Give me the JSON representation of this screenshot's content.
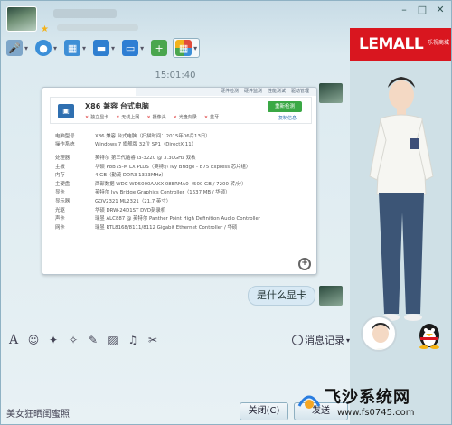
{
  "header": {
    "window_controls": [
      "–",
      "□",
      "✕"
    ]
  },
  "toolbar": {
    "items": [
      {
        "icon": "microphone-icon",
        "color": "#7ea6c9"
      },
      {
        "icon": "video-camera-icon",
        "color": "#3b8fd8"
      },
      {
        "icon": "screen-share-icon",
        "color": "#3f8fd6"
      },
      {
        "icon": "folder-icon",
        "color": "#2f7fd0"
      },
      {
        "icon": "remote-desktop-icon",
        "color": "#2e7ed3"
      },
      {
        "icon": "new-discussion-icon",
        "color": "#4aa64e"
      },
      {
        "icon": "app-grid-icon",
        "color": "#e14b3b"
      }
    ]
  },
  "chat": {
    "time": "15:01:40",
    "screenshot": {
      "tabs": [
        "硬件检测",
        "硬件监测",
        "性能测试",
        "驱动管理"
      ],
      "title": "X86 兼容 台式电脑",
      "checks": [
        "独立显卡",
        "无线上网",
        "摄像头",
        "光盘刻录",
        "蓝牙"
      ],
      "button": "重新检测",
      "link": "复制信息",
      "specs": [
        {
          "k": "电脑型号",
          "v": "X86 兼容 台式电脑（扫描时间：2015年06月13日）",
          "gap": false
        },
        {
          "k": "操作系统",
          "v": "Windows 7 旗舰版 32位 SP1（DirectX 11）",
          "gap": false
        },
        {
          "k": "处理器",
          "v": "英特尔 第三代酷睿 i3-3220 @ 3.30GHz 双核",
          "gap": true
        },
        {
          "k": "主板",
          "v": "华硕 P8B75-M LX PLUS（英特尔 Ivy Bridge - B75 Express 芯片组）",
          "gap": false
        },
        {
          "k": "内存",
          "v": "4 GB（勤茂 DDR3 1333MHz）",
          "gap": false
        },
        {
          "k": "主硬盘",
          "v": "西部数据 WDC WD5000AAKX-08ERMA0（500 GB / 7200 转/分）",
          "gap": false
        },
        {
          "k": "显卡",
          "v": "英特尔 Ivy Bridge Graphics Controller（1637 MB / 华硕）",
          "gap": false
        },
        {
          "k": "显示器",
          "v": "GOV2321 ML2321（21.7 英寸）",
          "gap": false
        },
        {
          "k": "光驱",
          "v": "华硕 DRW-24D1ST DVD刻录机",
          "gap": false
        },
        {
          "k": "声卡",
          "v": "瑞昱 ALC887 @ 英特尔 Panther Point High Definition Audio Controller",
          "gap": false
        },
        {
          "k": "网卡",
          "v": "瑞昱 RTL8168/8111/8112 Gigabit Ethernet Controller / 华硕",
          "gap": false
        }
      ]
    },
    "message": "是什么显卡"
  },
  "input_toolbar": {
    "icons": [
      "A",
      "☺",
      "✎",
      "✂",
      "▢",
      "♫"
    ],
    "icon_names": [
      "font-icon",
      "emoji-icon",
      "magic-icon",
      "shake-icon",
      "edit-icon",
      "image-icon",
      "music-icon",
      "scissors-icon"
    ],
    "history_label": "消息记录"
  },
  "bottom": {
    "left_text": "美女狂晒闺蜜照",
    "close_label": "关闭(C)",
    "send_label": "发送"
  },
  "ad": {
    "brand": "LEMALL",
    "sub": "乐视商城"
  },
  "watermark": {
    "title": "飞沙系统网",
    "url": "www.fs0745.com"
  },
  "colors": {
    "accent": "#d9161f",
    "send": "#3aa845"
  }
}
